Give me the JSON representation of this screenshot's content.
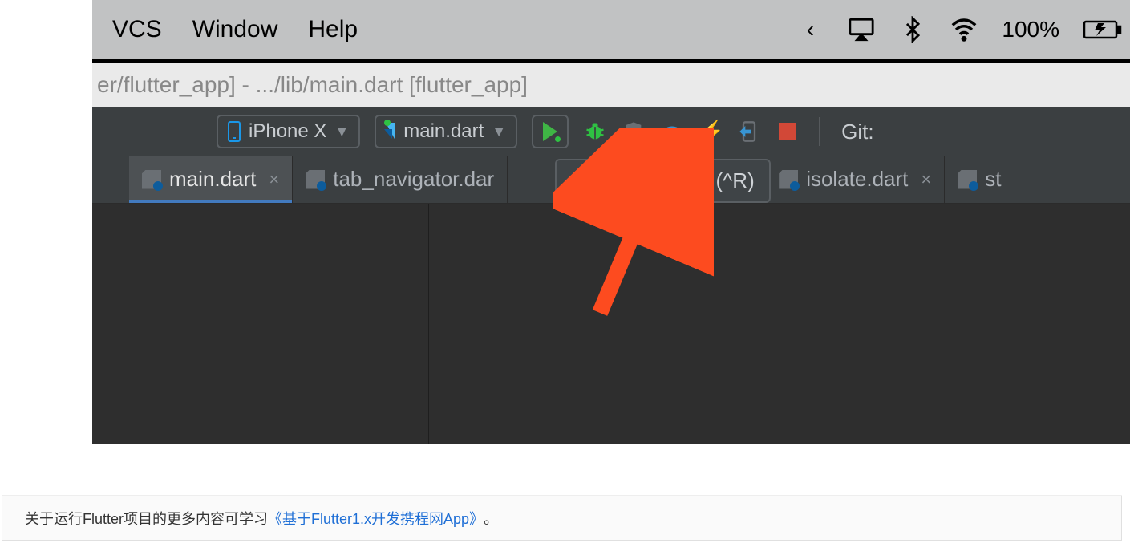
{
  "mac_menu": {
    "items": [
      "VCS",
      "Window",
      "Help"
    ],
    "battery_pct": "100%"
  },
  "window_title": "er/flutter_app] - .../lib/main.dart [flutter_app]",
  "toolbar": {
    "device_label": "iPhone X",
    "config_label": "main.dart",
    "git_label": "Git:"
  },
  "tooltip_text": "Run 'main.dart' (^R)",
  "tabs": [
    {
      "label": "main.dart",
      "closable": true,
      "active": true
    },
    {
      "label": "tab_navigator.dart",
      "closable": false,
      "active": false,
      "truncated": "tab_navigator.dar"
    },
    {
      "label": "isolate.dart",
      "closable": true,
      "active": false
    },
    {
      "label": "st",
      "closable": false,
      "active": false,
      "truncated": "st"
    }
  ],
  "note": {
    "prefix": "关于运行Flutter项目的更多内容可学习",
    "link": "《基于Flutter1.x开发携程网App》",
    "suffix": "。"
  }
}
